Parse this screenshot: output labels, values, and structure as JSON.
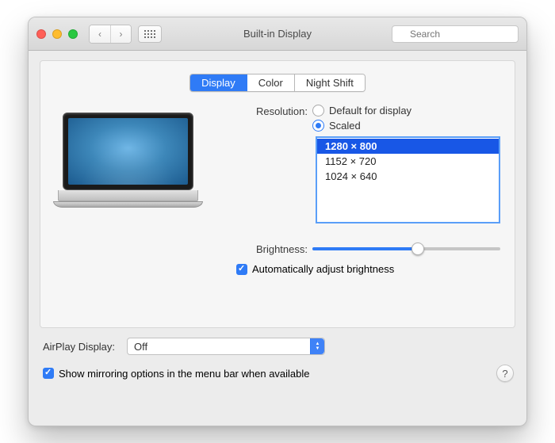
{
  "window": {
    "title": "Built-in Display",
    "search_placeholder": "Search"
  },
  "tabs": [
    {
      "label": "Display",
      "active": true
    },
    {
      "label": "Color",
      "active": false
    },
    {
      "label": "Night Shift",
      "active": false
    }
  ],
  "resolution": {
    "label": "Resolution:",
    "default_label": "Default for display",
    "scaled_label": "Scaled",
    "selected_mode": "scaled",
    "options": [
      {
        "label": "1280 × 800",
        "selected": true
      },
      {
        "label": "1152 × 720",
        "selected": false
      },
      {
        "label": "1024 × 640",
        "selected": false
      }
    ]
  },
  "brightness": {
    "label": "Brightness:",
    "value_percent": 56,
    "auto_label": "Automatically adjust brightness",
    "auto_checked": true
  },
  "airplay": {
    "label": "AirPlay Display:",
    "value": "Off"
  },
  "mirroring": {
    "label": "Show mirroring options in the menu bar when available",
    "checked": true
  },
  "help_label": "?"
}
